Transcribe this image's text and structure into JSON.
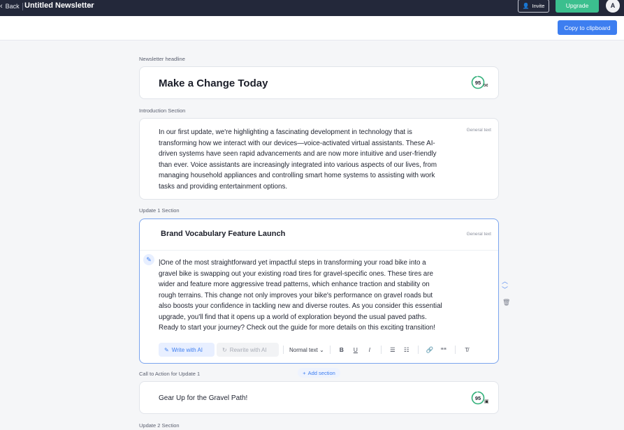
{
  "topbar": {
    "back_label": "Back",
    "doc_title": "Untitled Newsletter",
    "invite_label": "Invite",
    "upgrade_label": "Upgrade",
    "avatar_initial": "A"
  },
  "subbar": {
    "copy_label": "Copy to clipboard"
  },
  "headline": {
    "label": "Newsletter headline",
    "text": "Make a Change Today",
    "score": "95",
    "score_fraction": 0.95
  },
  "intro": {
    "label": "Introduction Section",
    "tag": "General text",
    "lines": [
      "In our first update, we're highlighting a fascinating development in technology that is",
      "transforming how we interact with our devices—voice-activated virtual assistants. These AI-",
      "driven systems have seen rapid advancements and are now more intuitive and user-friendly",
      "than ever. Voice assistants are increasingly integrated into various aspects of our lives, from",
      "managing household appliances and controlling smart home systems to assisting with work",
      "tasks and providing entertainment options."
    ]
  },
  "update1": {
    "label": "Update 1 Section",
    "title": "Brand Vocabulary Feature Launch",
    "tag": "General text",
    "lines": [
      "|One of the most straightforward yet impactful steps in transforming your road bike into a",
      "gravel bike is swapping out your existing road tires for gravel-specific ones. These tires are",
      "wider and feature more aggressive tread patterns, which enhance traction and stability on",
      "rough terrains. This change not only improves your bike's performance on gravel roads but",
      "also boosts your confidence in tackling new and diverse routes. As you consider this essential",
      "upgrade, you'll find that it opens up a world of exploration beyond the usual paved paths.",
      "Ready to start your journey? Check out the guide for more details on this exciting transition!"
    ],
    "toolbar": {
      "write_ai": "Write with AI",
      "rewrite_ai": "Rewrite with AI",
      "normal_text": "Normal text",
      "bold": "B",
      "underline": "U",
      "italic": "I",
      "quote": "““",
      "clear_format": "T̸"
    }
  },
  "add_section_label": "Add section",
  "cta": {
    "label": "Call to Action for Update 1",
    "text": "Gear Up for the Gravel Path!",
    "score": "95",
    "score_fraction": 0.95
  },
  "update2": {
    "label": "Update 2 Section"
  },
  "colors": {
    "topbar": "#23283a",
    "accent": "#3d7ef0",
    "upgrade": "#3bbf8e",
    "score_ring": "#34b27b"
  }
}
